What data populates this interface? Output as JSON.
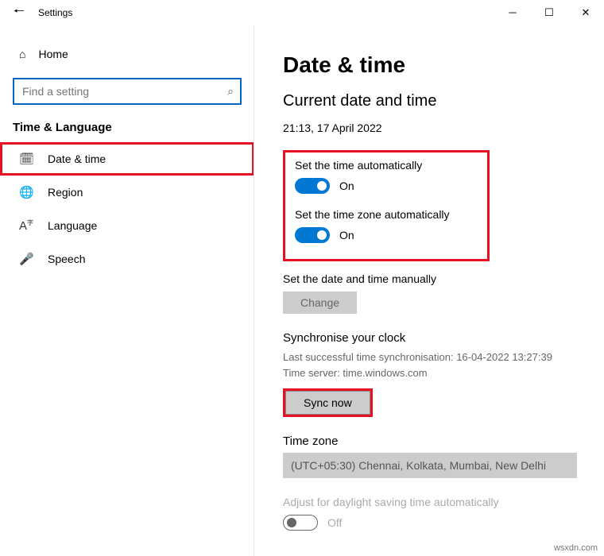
{
  "window": {
    "title": "Settings"
  },
  "sidebar": {
    "home": "Home",
    "search_placeholder": "Find a setting",
    "category": "Time & Language",
    "items": [
      {
        "label": "Date & time"
      },
      {
        "label": "Region"
      },
      {
        "label": "Language"
      },
      {
        "label": "Speech"
      }
    ]
  },
  "page": {
    "heading": "Date & time",
    "subheading": "Current date and time",
    "datetime": "21:13, 17 April 2022",
    "auto_time_label": "Set the time automatically",
    "auto_time_state": "On",
    "auto_tz_label": "Set the time zone automatically",
    "auto_tz_state": "On",
    "manual_label": "Set the date and time manually",
    "change_btn": "Change",
    "sync_heading": "Synchronise your clock",
    "sync_last": "Last successful time synchronisation: 16-04-2022 13:27:39",
    "sync_server": "Time server: time.windows.com",
    "sync_btn": "Sync now",
    "tz_heading": "Time zone",
    "tz_value": "(UTC+05:30) Chennai, Kolkata, Mumbai, New Delhi",
    "dst_label": "Adjust for daylight saving time automatically",
    "dst_state": "Off"
  },
  "watermark": "wsxdn.com"
}
